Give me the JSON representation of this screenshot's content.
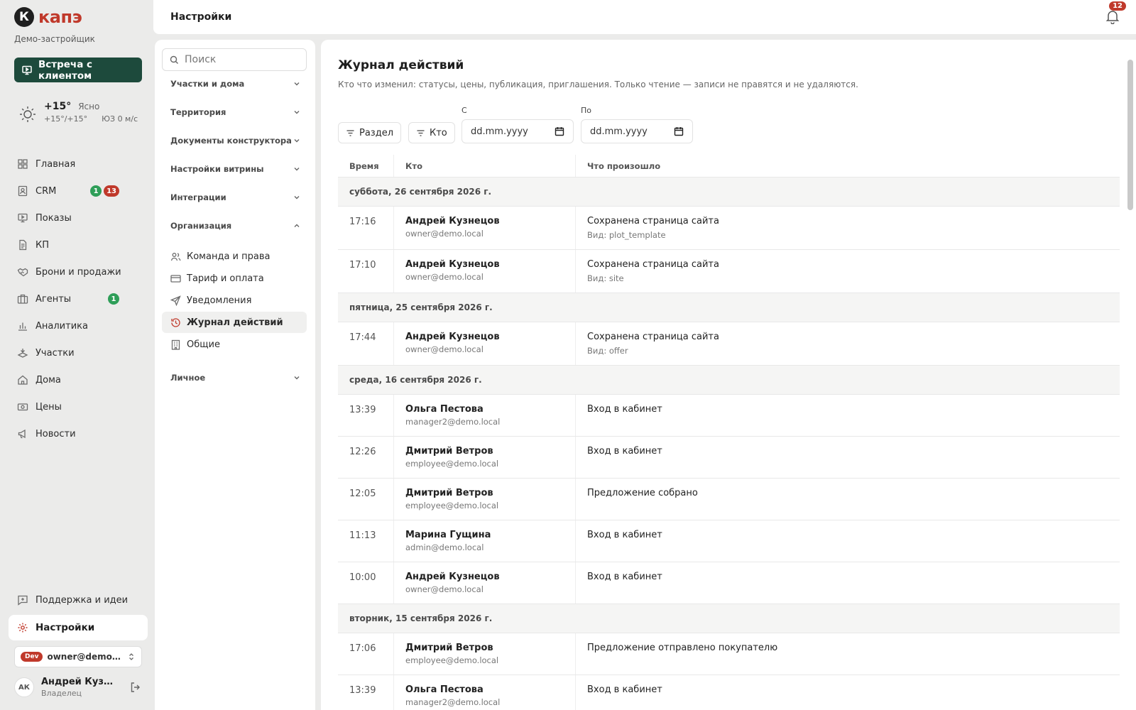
{
  "brand": {
    "logo_letter": "К",
    "name": "капэ",
    "company": "Демо-застройщик",
    "color": "#c0392b"
  },
  "meet_button": {
    "label": "Встреча с клиентом",
    "color": "#1d4a3c"
  },
  "weather": {
    "temp": "+15°",
    "desc": "Ясно",
    "range": "+15°/+15°",
    "wind": "ЮЗ 0 м/с"
  },
  "nav": {
    "items": [
      {
        "label": "Главная",
        "icon": "grid-icon"
      },
      {
        "label": "CRM",
        "icon": "contacts-icon",
        "badge_green": "1",
        "badge_red": "13"
      },
      {
        "label": "Показы",
        "icon": "presentation-icon"
      },
      {
        "label": "КП",
        "icon": "document-icon"
      },
      {
        "label": "Брони и продажи",
        "icon": "handshake-icon"
      },
      {
        "label": "Агенты",
        "icon": "briefcase-icon",
        "badge_green": "1"
      },
      {
        "label": "Аналитика",
        "icon": "bar-chart-icon"
      },
      {
        "label": "Участки",
        "icon": "plot-icon"
      },
      {
        "label": "Дома",
        "icon": "home-icon"
      },
      {
        "label": "Цены",
        "icon": "price-icon"
      },
      {
        "label": "Новости",
        "icon": "megaphone-icon"
      }
    ],
    "support": "Поддержка и идеи",
    "settings": "Настройки"
  },
  "account": {
    "env": "Dev",
    "email": "owner@demo.local"
  },
  "user": {
    "initials": "АК",
    "name": "Андрей Кузнецов",
    "role": "Владелец"
  },
  "topbar": {
    "title": "Настройки",
    "notifications": "12"
  },
  "subpanel": {
    "search_placeholder": "Поиск",
    "sections": [
      "Участки и дома",
      "Территория",
      "Документы конструктора",
      "Настройки витрины",
      "Интеграции",
      "Организация"
    ],
    "org_items": [
      {
        "label": "Команда и права",
        "icon": "users-icon"
      },
      {
        "label": "Тариф и оплата",
        "icon": "credit-card-icon"
      },
      {
        "label": "Уведомления",
        "icon": "send-icon"
      },
      {
        "label": "Журнал действий",
        "icon": "history-icon",
        "active": true
      },
      {
        "label": "Общие",
        "icon": "building-icon"
      }
    ],
    "personal": "Личное"
  },
  "main": {
    "title": "Журнал действий",
    "description": "Кто что изменил: статусы, цены, публикация, приглашения. Только чтение — записи не правятся и не удаляются.",
    "filters": {
      "section": "Раздел",
      "who": "Кто"
    },
    "date_from_label": "С",
    "date_to_label": "По",
    "date_placeholder": "dd.mm.yyyy",
    "columns": {
      "time": "Время",
      "who": "Кто",
      "what": "Что произошло"
    },
    "groups": [
      {
        "day": "суббота, 26 сентября 2026 г.",
        "rows": [
          {
            "time": "17:16",
            "name": "Андрей Кузнецов",
            "email": "owner@demo.local",
            "what": "Сохранена страница сайта",
            "detail": "Вид: plot_template"
          },
          {
            "time": "17:10",
            "name": "Андрей Кузнецов",
            "email": "owner@demo.local",
            "what": "Сохранена страница сайта",
            "detail": "Вид: site"
          }
        ]
      },
      {
        "day": "пятница, 25 сентября 2026 г.",
        "rows": [
          {
            "time": "17:44",
            "name": "Андрей Кузнецов",
            "email": "owner@demo.local",
            "what": "Сохранена страница сайта",
            "detail": "Вид: offer"
          }
        ]
      },
      {
        "day": "среда, 16 сентября 2026 г.",
        "rows": [
          {
            "time": "13:39",
            "name": "Ольга Пестова",
            "email": "manager2@demo.local",
            "what": "Вход в кабинет",
            "detail": ""
          },
          {
            "time": "12:26",
            "name": "Дмитрий Ветров",
            "email": "employee@demo.local",
            "what": "Вход в кабинет",
            "detail": ""
          },
          {
            "time": "12:05",
            "name": "Дмитрий Ветров",
            "email": "employee@demo.local",
            "what": "Предложение собрано",
            "detail": ""
          },
          {
            "time": "11:13",
            "name": "Марина Гущина",
            "email": "admin@demo.local",
            "what": "Вход в кабинет",
            "detail": ""
          },
          {
            "time": "10:00",
            "name": "Андрей Кузнецов",
            "email": "owner@demo.local",
            "what": "Вход в кабинет",
            "detail": ""
          }
        ]
      },
      {
        "day": "вторник, 15 сентября 2026 г.",
        "rows": [
          {
            "time": "17:06",
            "name": "Дмитрий Ветров",
            "email": "employee@demo.local",
            "what": "Предложение отправлено покупателю",
            "detail": ""
          },
          {
            "time": "13:39",
            "name": "Ольга Пестова",
            "email": "manager2@demo.local",
            "what": "Вход в кабинет",
            "detail": ""
          }
        ]
      }
    ]
  }
}
